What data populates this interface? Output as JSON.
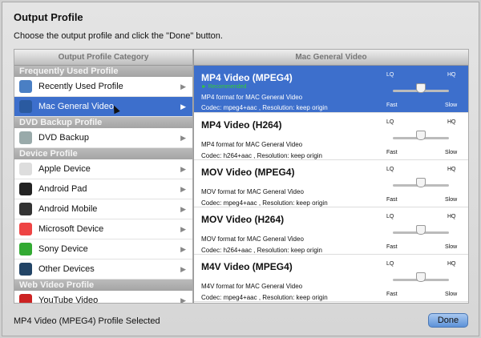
{
  "window": {
    "title": "Output Profile",
    "subtitle": "Choose the output profile and click the \"Done\" button."
  },
  "left": {
    "header": "Output Profile Category",
    "groups": [
      {
        "label": "Frequently Used Profile",
        "items": [
          {
            "label": "Recently Used Profile",
            "icon": "monitor-icon",
            "color": "#4a7fc4"
          },
          {
            "label": "Mac General Video",
            "icon": "video-icon",
            "color": "#2a5aa0"
          }
        ]
      },
      {
        "label": "DVD Backup Profile",
        "items": [
          {
            "label": "DVD Backup",
            "icon": "disc-icon",
            "color": "#9aa"
          }
        ]
      },
      {
        "label": "Device Profile",
        "items": [
          {
            "label": "Apple Device",
            "icon": "apple-icon",
            "color": "#ddd"
          },
          {
            "label": "Android Pad",
            "icon": "android-pad-icon",
            "color": "#222"
          },
          {
            "label": "Android Mobile",
            "icon": "android-mobile-icon",
            "color": "#333"
          },
          {
            "label": "Microsoft Device",
            "icon": "windows-icon",
            "color": "#e44"
          },
          {
            "label": "Sony Device",
            "icon": "sony-icon",
            "color": "#3a3"
          },
          {
            "label": "Other Devices",
            "icon": "phone-icon",
            "color": "#246"
          }
        ]
      },
      {
        "label": "Web Video Profile",
        "items": [
          {
            "label": "YouTube Video",
            "icon": "youtube-icon",
            "color": "#c22"
          }
        ]
      }
    ]
  },
  "right": {
    "header": "Mac General Video",
    "lq": "LQ",
    "hq": "HQ",
    "fast": "Fast",
    "slow": "Slow",
    "profiles": [
      {
        "name": "MP4 Video (MPEG4)",
        "recommended": "► Recommended",
        "desc": "MP4 format for MAC General Video",
        "codec": "Codec: mpeg4+aac , Resolution: keep origin"
      },
      {
        "name": "MP4 Video (H264)",
        "desc": "MP4 format for MAC General Video",
        "codec": "Codec: h264+aac , Resolution: keep origin"
      },
      {
        "name": "MOV Video (MPEG4)",
        "desc": "MOV format for MAC General Video",
        "codec": "Codec: mpeg4+aac , Resolution: keep origin"
      },
      {
        "name": "MOV Video (H264)",
        "desc": "MOV format for MAC General Video",
        "codec": "Codec: h264+aac , Resolution: keep origin"
      },
      {
        "name": "M4V Video (MPEG4)",
        "desc": "M4V format for MAC General Video",
        "codec": "Codec: mpeg4+aac , Resolution: keep origin"
      }
    ]
  },
  "quality_level": 0.5,
  "status": "MP4 Video (MPEG4) Profile Selected",
  "done_label": "Done",
  "accent": "#3d6fcc"
}
